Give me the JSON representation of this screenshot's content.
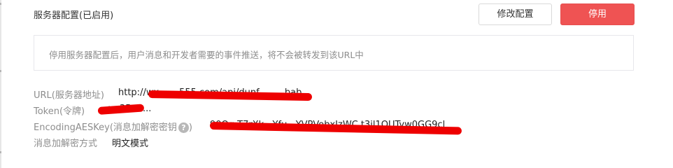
{
  "header": {
    "title": "服务器配置(已启用)",
    "edit_label": "修改配置",
    "disable_label": "停用"
  },
  "notice": {
    "text": "停用服务器配置后，用户消息和开发者需要的事件推送，将不会被转发到该URL中"
  },
  "config": {
    "url": {
      "label": "URL(服务器地址)",
      "value": "http://wx.......555.com/api/dunf.........bab"
    },
    "token": {
      "label": "Token(令牌)",
      "value": "...ug35..2..."
    },
    "aes_key": {
      "label": "EncodingAESKey(消息加解密密钥",
      "label_suffix": ")",
      "help": "?",
      "value": "90Qg.T7rXk...Yfu...YVPVobxIzWC.t3jl1OUTyw0GG9cl"
    },
    "mode": {
      "label": "消息加解密方式",
      "value": "明文模式"
    }
  },
  "colors": {
    "primary_danger": "#ef5353",
    "redaction": "#ee0000"
  }
}
